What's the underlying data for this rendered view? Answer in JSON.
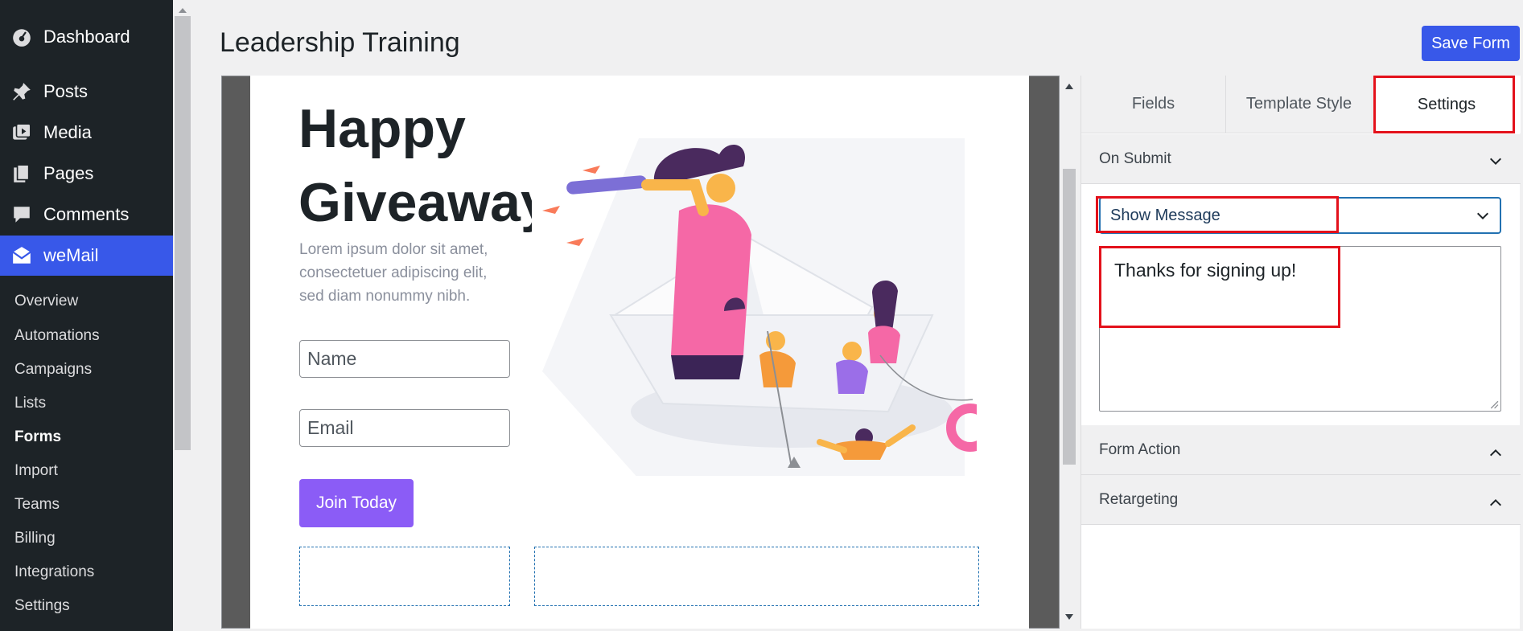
{
  "sidebar": {
    "top_items": [
      {
        "label": "Dashboard",
        "icon": "dashboard-icon"
      },
      {
        "label": "Posts",
        "icon": "pin-icon"
      },
      {
        "label": "Media",
        "icon": "media-icon"
      },
      {
        "label": "Pages",
        "icon": "pages-icon"
      },
      {
        "label": "Comments",
        "icon": "comment-icon"
      },
      {
        "label": "weMail",
        "icon": "envelope-icon"
      }
    ],
    "submenu": [
      "Overview",
      "Automations",
      "Campaigns",
      "Lists",
      "Forms",
      "Import",
      "Teams",
      "Billing",
      "Integrations",
      "Settings"
    ],
    "current_submenu": "Forms"
  },
  "header": {
    "title": "Leadership Training",
    "save_label": "Save Form"
  },
  "form_preview": {
    "headline_line1": "Happy",
    "headline_line2": "Giveaway",
    "body_text": "Lorem ipsum dolor sit amet, consectetuer adipiscing elit, sed diam nonummy nibh.",
    "name_placeholder": "Name",
    "email_placeholder": "Email",
    "button_label": "Join Today"
  },
  "panel": {
    "tabs": [
      {
        "label": "Fields"
      },
      {
        "label": "Template Style"
      },
      {
        "label": "Settings"
      }
    ],
    "active_tab": "Settings",
    "on_submit": {
      "title": "On Submit",
      "selected_option": "Show Message",
      "message": "Thanks for signing up!"
    },
    "form_action": {
      "title": "Form Action"
    },
    "retargeting": {
      "title": "Retargeting"
    }
  },
  "colors": {
    "accent": "#3858e9",
    "button_purple": "#8b5cf6",
    "highlight": "#e3111b",
    "sidebar_bg": "#1d2327"
  }
}
